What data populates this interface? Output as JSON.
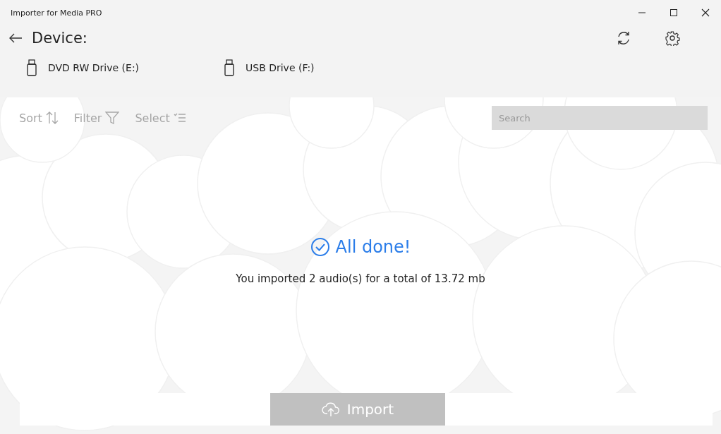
{
  "window": {
    "title": "Importer for Media PRO"
  },
  "header": {
    "title": "Device:"
  },
  "devices": [
    {
      "label": "DVD RW Drive (E:)"
    },
    {
      "label": "USB Drive (F:)"
    }
  ],
  "toolbar": [
    {
      "label": "Sort",
      "kind": "sort",
      "disabled": true
    },
    {
      "label": "Filter",
      "kind": "filter",
      "disabled": true
    },
    {
      "label": "Select",
      "kind": "select",
      "disabled": true
    }
  ],
  "search": {
    "placeholder": "Search"
  },
  "result": {
    "heading": "All done!",
    "message": "You imported 2 audio(s) for a total of 13.72 mb"
  },
  "import_button": {
    "label": "Import",
    "disabled": true
  }
}
